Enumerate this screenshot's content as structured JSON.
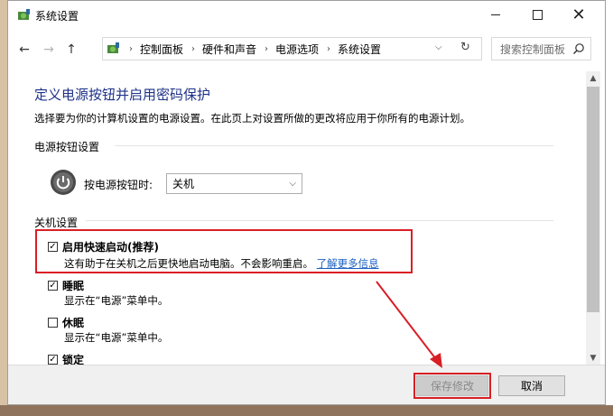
{
  "window": {
    "title": "系统设置",
    "icon": "power-options-icon",
    "controls": {
      "minimize": "minimize-icon",
      "maximize": "maximize-icon",
      "close": "close-icon"
    }
  },
  "nav": {
    "back": "←",
    "forward": "→",
    "up": "↑",
    "breadcrumb": [
      "控制面板",
      "硬件和声音",
      "电源选项",
      "系统设置"
    ],
    "search_placeholder": "搜索控制面板"
  },
  "main": {
    "heading": "定义电源按钮并启用密码保护",
    "description": "选择要为你的计算机设置的电源设置。在此页上对设置所做的更改将应用于你所有的电源计划。",
    "power_section": {
      "title": "电源按钮设置",
      "label": "按电源按钮时:",
      "selected": "关机"
    },
    "shutdown_section": {
      "title": "关机设置",
      "options": [
        {
          "label": "启用快速启动(推荐)",
          "checked": true,
          "desc": "这有助于在关机之后更快地启动电脑。不会影响重启。",
          "link": "了解更多信息"
        },
        {
          "label": "睡眠",
          "checked": true,
          "desc": "显示在“电源”菜单中。"
        },
        {
          "label": "休眠",
          "checked": false,
          "desc": "显示在“电源”菜单中。"
        },
        {
          "label": "锁定",
          "checked": true
        }
      ]
    }
  },
  "footer": {
    "save": "保存修改",
    "cancel": "取消"
  },
  "colors": {
    "heading": "#1e3287",
    "highlight": "#d91f26",
    "link": "#1b5ec1"
  }
}
